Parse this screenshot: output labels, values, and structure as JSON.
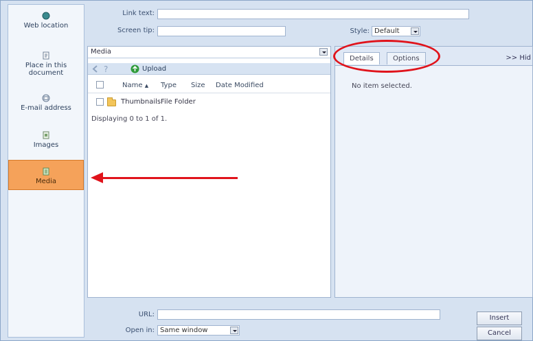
{
  "nav": {
    "items": [
      {
        "label": "Web location",
        "icon": "globe-icon"
      },
      {
        "label": "Place in this document",
        "icon": "anchor-icon"
      },
      {
        "label": "E-mail address",
        "icon": "mail-icon"
      },
      {
        "label": "Images",
        "icon": "image-icon"
      },
      {
        "label": "Media",
        "icon": "media-icon",
        "active": true
      }
    ]
  },
  "top_form": {
    "link_text_label": "Link text:",
    "link_text_value": "",
    "screen_tip_label": "Screen tip:",
    "screen_tip_value": "",
    "style_label": "Style:",
    "style_value": "Default"
  },
  "file_browser": {
    "folder_select": "Media",
    "upload_label": "Upload",
    "columns": [
      "Name",
      "Type",
      "Size",
      "Date Modified"
    ],
    "sort_indicator": "▲",
    "rows": [
      {
        "name": "Thumbnails",
        "type": "File Folder",
        "size": "",
        "date": ""
      }
    ],
    "status_text": "Displaying 0 to 1 of 1."
  },
  "details": {
    "tabs": [
      "Details",
      "Options"
    ],
    "hide_label": ">> Hid",
    "empty_text": "No item selected."
  },
  "bottom": {
    "url_label": "URL:",
    "url_value": "",
    "open_in_label": "Open in:",
    "open_in_value": "Same window",
    "insert_label": "Insert",
    "cancel_label": "Cancel"
  },
  "colors": {
    "active_nav": "#f5a25a",
    "annotation": "#e0131b",
    "panel_bg": "#d6e2f1"
  }
}
